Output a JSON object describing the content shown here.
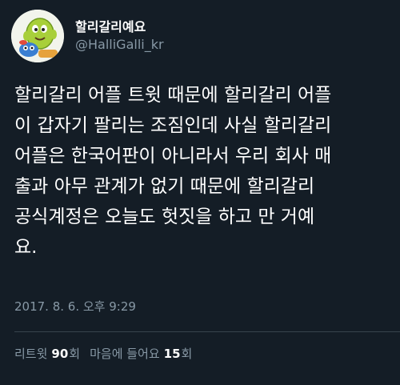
{
  "user": {
    "display_name": "할리갈리예요",
    "handle": "@HalliGalli_kr",
    "avatar_icon": "halligalli-mascot-avatar"
  },
  "tweet": {
    "lines": [
      "할리갈리 어플 트윗 때문에 할리갈리 어플",
      "이 갑자기 팔리는 조짐인데 사실 할리갈리",
      "어플은 한국어판이 아니라서 우리 회사 매",
      "출과 아무 관계가 없기 때문에 할리갈리",
      "공식계정은 오늘도 헛짓을 하고 만 거예",
      "요."
    ],
    "timestamp": "2017. 8. 6. 오후 9:29"
  },
  "stats": {
    "retweet_label": "리트윗",
    "retweet_count": "90",
    "retweet_unit": "회",
    "like_label": "마음에 들어요",
    "like_count": "15",
    "like_unit": "회"
  },
  "colors": {
    "background": "#141d26",
    "text": "#ffffff",
    "secondary_text": "#8899a6",
    "divider": "#38444d"
  }
}
